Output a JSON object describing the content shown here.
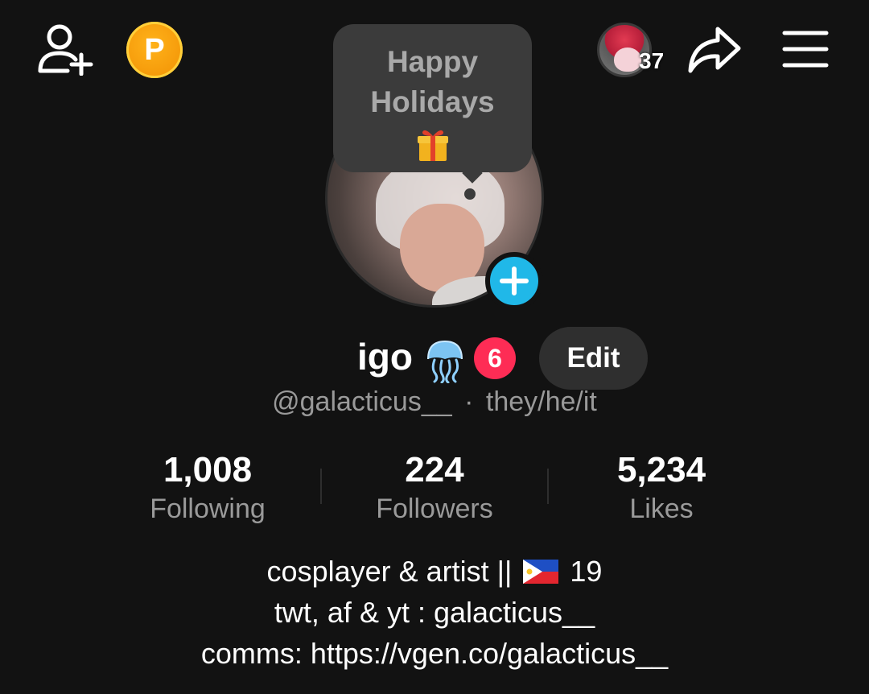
{
  "bubble": {
    "line1": "Happy",
    "line2": "Holidays"
  },
  "notifications": {
    "count": "37"
  },
  "profile": {
    "display_name": "igo",
    "badge_count": "6",
    "edit_label": "Edit",
    "handle": "@galacticus__",
    "separator": "·",
    "pronouns": "they/he/it"
  },
  "stats": [
    {
      "value": "1,008",
      "label": "Following"
    },
    {
      "value": "224",
      "label": "Followers"
    },
    {
      "value": "5,234",
      "label": "Likes"
    }
  ],
  "bio": {
    "line1_a": "cosplayer & artist ||",
    "line1_b": "19",
    "line2": "twt, af & yt : galacticus__",
    "line3": "comms: https://vgen.co/galacticus__"
  },
  "points_letter": "P",
  "colors": {
    "accent_blue": "#20b8e8",
    "badge_red": "#fe2c55",
    "points_gold": "#f59a0a",
    "background": "#121212"
  },
  "icons": [
    "add-friend-icon",
    "points-icon",
    "share-icon",
    "menu-icon",
    "plus-icon",
    "gift-icon",
    "jellyfish-icon",
    "philippines-flag-icon"
  ]
}
